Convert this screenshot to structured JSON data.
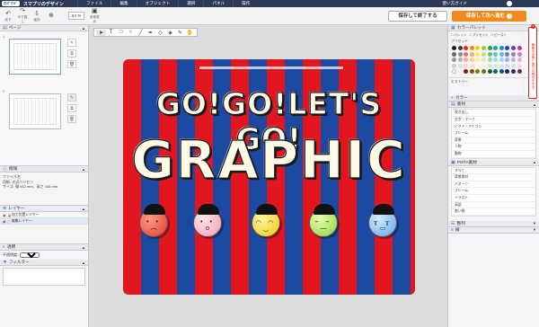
{
  "menubar": {
    "logo": "ｵﾝﾃﾞﾏﾝﾄﾞ",
    "brand": "スマプリのデザイン",
    "items": [
      "ファイル",
      "編集",
      "オブジェクト",
      "選択",
      "パネル",
      "操作"
    ],
    "guide": "使い方ガイド"
  },
  "toolbar": {
    "buttons": [
      {
        "icon": "undo-icon",
        "label": "戻す"
      },
      {
        "icon": "redo-icon",
        "label": "やり直し"
      },
      {
        "icon": "save-icon",
        "label": "保存"
      },
      {
        "icon": "zoom-icon",
        "label": ""
      },
      {
        "icon": "fit-icon",
        "label": "全体表示"
      }
    ],
    "zoom_value": "64 %",
    "save_exit": "保存して終了する",
    "save_next": "保存して次へ進む",
    "save_next_badge": "!"
  },
  "left": {
    "pages_title": "ページ",
    "page1": "1",
    "page2": "2",
    "info_title": "情報",
    "info_lines": [
      "ファイル名",
      "用紙: 光沢バリセン",
      "サイズ: 幅 612 mm、高さ 446 mm"
    ],
    "layers_title": "レイヤー",
    "layers": [
      "加工位置レイヤー",
      "編集レイヤー"
    ],
    "opacity_title": "透明",
    "opacity_label": "不透明度",
    "opacity_value": "100 %",
    "filter_title": "フィルター"
  },
  "canvas": {
    "headline1": "GO!GO!LET'S GO!",
    "headline2": "GRAPHIC"
  },
  "right": {
    "palette_title": "カラーパレット",
    "opts": [
      "パレット",
      "プリセット",
      "ピースト"
    ],
    "preset_label": "プリセット",
    "history_label": "ヒストリー",
    "color_title": "カラー",
    "materials_title": "素材",
    "materials": [
      "吹き出し",
      "文字・マーク",
      "ピクト・アイコン",
      "フレーム",
      "背景",
      "人物",
      "動物"
    ],
    "pixta_title": "PIXTA素材",
    "pixta": [
      "すべて",
      "背景素材",
      "パターン",
      "フレーム",
      "イラスト",
      "英語",
      "書い物"
    ],
    "align_title": "整列",
    "line_title": "線",
    "side_tab": "編集の全体と表示の検出をする",
    "colors": [
      "#1a1a1a",
      "#3a3a3a",
      "#e0281f",
      "#f08a1c",
      "#f5d300",
      "#9ccc2a",
      "#20a24a",
      "#18a6a0",
      "#1c8ad8",
      "#1c4aa3",
      "#6a3aa8",
      "#c03a8a",
      "#666666",
      "#8a8a8a",
      "#f26b5b",
      "#f6a860",
      "#f8e36a",
      "#c1de6e",
      "#5cc07a",
      "#5cc7c2",
      "#6ab2e8",
      "#5c7fc6",
      "#9778c4",
      "#d77aae",
      "#999999",
      "#b3b3b3",
      "#f7a89e",
      "#f9c89e",
      "#fbee9e",
      "#dcebaa",
      "#9ed9ab",
      "#9edfdc",
      "#a6d0f1",
      "#9fb3de",
      "#c0aedc",
      "#e8b0cf",
      "#cccccc",
      "#e0e0e0",
      "#fbd3cd",
      "#fce2cc",
      "#fdf6cd",
      "#eef5d5",
      "#cfecd5",
      "#cfefed",
      "#d3e7f8",
      "#cfd9ee",
      "#e0d6ed",
      "#f4d8e7",
      "#ffffff",
      "#f2f2f2",
      "#8a1a14",
      "#8a4a0e",
      "#8a7a00",
      "#5a7a14",
      "#12602a",
      "#0e6460",
      "#0e5080",
      "#0e2a60",
      "#3e2262",
      "#702250"
    ]
  }
}
